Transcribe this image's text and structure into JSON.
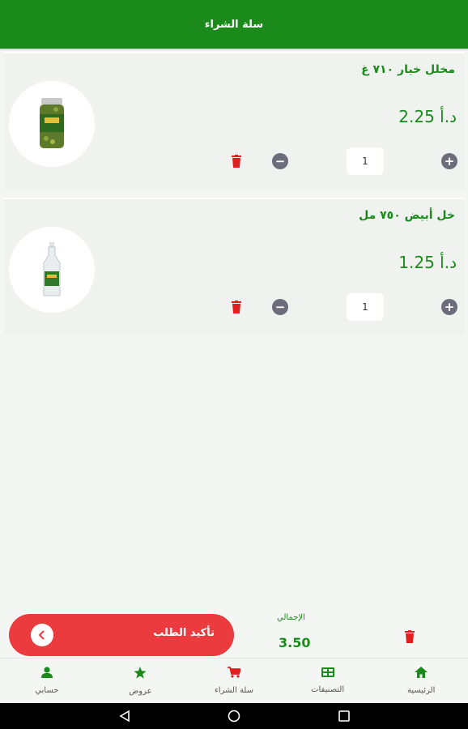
{
  "header": {
    "title": "سلة الشراء"
  },
  "cart": {
    "items": [
      {
        "name": "مخلل خيار ٧١٠ غ",
        "price": "2.25 د.أ",
        "quantity": "1",
        "image_icon": "pickle-jar-icon"
      },
      {
        "name": "خل أبيض ٧٥٠ مل",
        "price": "1.25 د.أ",
        "quantity": "1",
        "image_icon": "vinegar-bottle-icon"
      }
    ]
  },
  "footer": {
    "confirm_label": "تأكيد الطلب",
    "total_label": "الإجمالي",
    "total_value": "3.50"
  },
  "nav": {
    "items": [
      {
        "label": "الرئيسية",
        "icon": "home-icon"
      },
      {
        "label": "التصنيفات",
        "icon": "categories-icon"
      },
      {
        "label": "سلة الشراء",
        "icon": "cart-icon"
      },
      {
        "label": "عروض",
        "icon": "star-icon"
      },
      {
        "label": "حسابي",
        "icon": "person-icon"
      }
    ]
  },
  "colors": {
    "brand_green": "#1a8a1a",
    "accent_red": "#ec3b3f",
    "button_gray": "#6b6e7a"
  }
}
